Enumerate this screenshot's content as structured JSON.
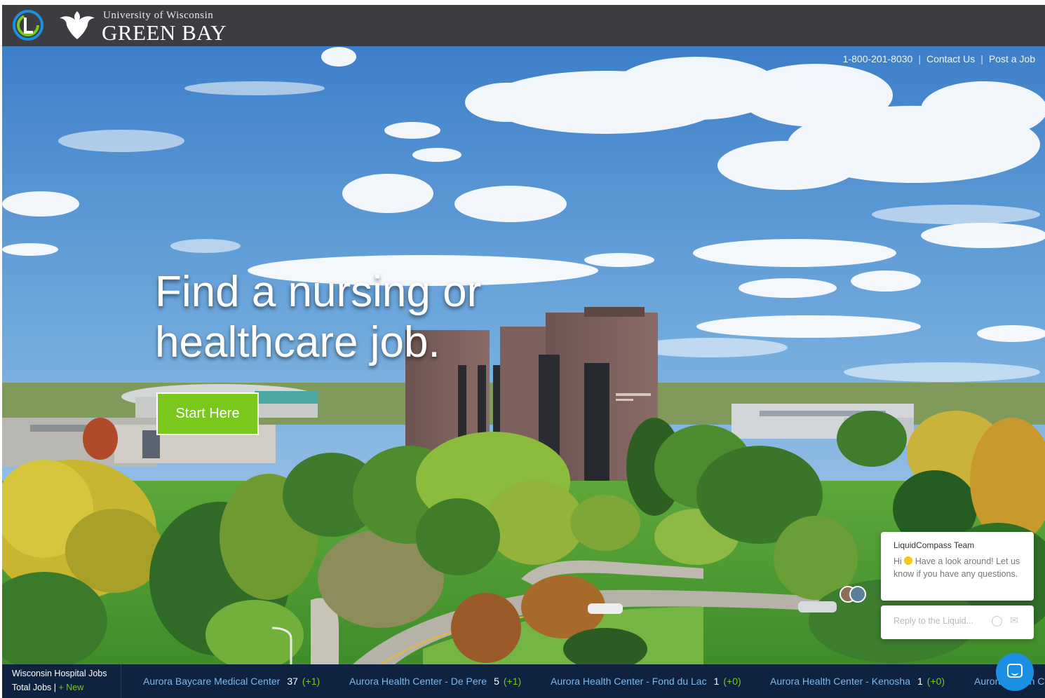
{
  "brand": {
    "app_logo": "liquidcompass-logo",
    "university_line1": "University of Wisconsin",
    "university_line2": "GREEN BAY"
  },
  "utility_nav": {
    "phone": "1-800-201-8030",
    "contact": "Contact Us",
    "post_job": "Post a Job"
  },
  "hero": {
    "headline_line1": "Find a nursing or",
    "headline_line2": "healthcare job.",
    "cta_label": "Start Here",
    "cta_color": "#7ac81c"
  },
  "chat": {
    "team_name": "LiquidCompass Team",
    "greeting_before": "Hi ",
    "greeting_after": " Have a look around! Let us know if you have any questions.",
    "reply_placeholder": "Reply to the Liquid...",
    "launcher_color": "#1a8fe3"
  },
  "ticker": {
    "title": "Wisconsin Hospital Jobs",
    "total_label": "Total Jobs |",
    "new_label": "+ New",
    "items": [
      {
        "name": "Aurora Baycare Medical Center",
        "count": "37",
        "delta": "(+1)"
      },
      {
        "name": "Aurora Health Center - De Pere",
        "count": "5",
        "delta": "(+1)"
      },
      {
        "name": "Aurora Health Center - Fond du Lac",
        "count": "1",
        "delta": "(+0)"
      },
      {
        "name": "Aurora Health Center - Kenosha",
        "count": "1",
        "delta": "(+0)"
      },
      {
        "name": "Aurora Health Center",
        "count": "",
        "delta": ""
      }
    ]
  }
}
